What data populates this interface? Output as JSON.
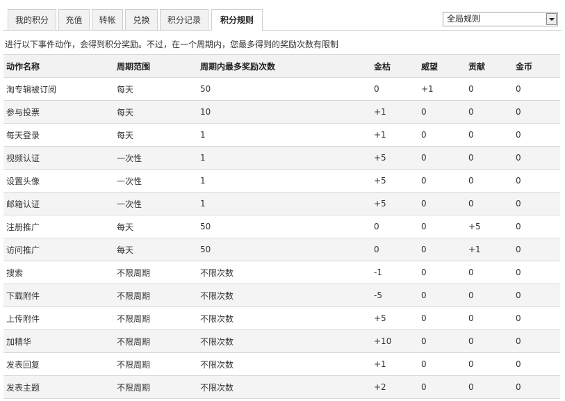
{
  "tabs": [
    {
      "label": "我的积分",
      "active": false
    },
    {
      "label": "充值",
      "active": false
    },
    {
      "label": "转帐",
      "active": false
    },
    {
      "label": "兑换",
      "active": false
    },
    {
      "label": "积分记录",
      "active": false
    },
    {
      "label": "积分规则",
      "active": true
    }
  ],
  "scope_select": {
    "value": "全局规则"
  },
  "description": "进行以下事件动作，会得到积分奖励。不过，在一个周期内，您最多得到的奖励次数有限制",
  "table": {
    "headers": [
      "动作名称",
      "周期范围",
      "周期内最多奖励次数",
      "金枯",
      "威望",
      "贡献",
      "金币"
    ],
    "rows": [
      [
        "淘专辑被订阅",
        "每天",
        "50",
        "0",
        "+1",
        "0",
        "0"
      ],
      [
        "参与投票",
        "每天",
        "10",
        "+1",
        "0",
        "0",
        "0"
      ],
      [
        "每天登录",
        "每天",
        "1",
        "+1",
        "0",
        "0",
        "0"
      ],
      [
        "视频认证",
        "一次性",
        "1",
        "+5",
        "0",
        "0",
        "0"
      ],
      [
        "设置头像",
        "一次性",
        "1",
        "+5",
        "0",
        "0",
        "0"
      ],
      [
        "邮箱认证",
        "一次性",
        "1",
        "+5",
        "0",
        "0",
        "0"
      ],
      [
        "注册推广",
        "每天",
        "50",
        "0",
        "0",
        "+5",
        "0"
      ],
      [
        "访问推广",
        "每天",
        "50",
        "0",
        "0",
        "+1",
        "0"
      ],
      [
        "搜索",
        "不限周期",
        "不限次数",
        "-1",
        "0",
        "0",
        "0"
      ],
      [
        "下载附件",
        "不限周期",
        "不限次数",
        "-5",
        "0",
        "0",
        "0"
      ],
      [
        "上传附件",
        "不限周期",
        "不限次数",
        "+5",
        "0",
        "0",
        "0"
      ],
      [
        "加精华",
        "不限周期",
        "不限次数",
        "+10",
        "0",
        "0",
        "0"
      ],
      [
        "发表回复",
        "不限周期",
        "不限次数",
        "+1",
        "0",
        "0",
        "0"
      ],
      [
        "发表主题",
        "不限周期",
        "不限次数",
        "+2",
        "0",
        "0",
        "0"
      ]
    ]
  }
}
